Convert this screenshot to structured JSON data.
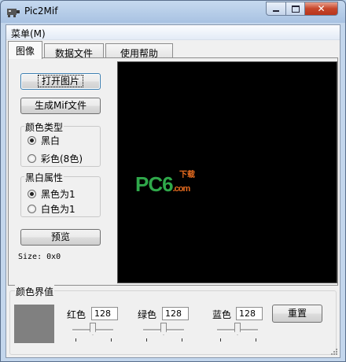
{
  "window": {
    "title": "Pic2Mif"
  },
  "menubar": {
    "menu_label": "菜单(M)"
  },
  "tabs": [
    {
      "label": "图像",
      "active": true
    },
    {
      "label": "数据文件",
      "active": false
    },
    {
      "label": "使用帮助",
      "active": false
    }
  ],
  "image_tab": {
    "open_button": "打开图片",
    "generate_button": "生成Mif文件",
    "color_type": {
      "title": "颜色类型",
      "options": [
        "黑白",
        "彩色(8色)"
      ],
      "selected": "黑白"
    },
    "bw_attr": {
      "title": "黑白属性",
      "options": [
        "黑色为1",
        "白色为1"
      ],
      "selected": "黑色为1"
    },
    "preview_button": "预览",
    "size_text": "Size: 0x0"
  },
  "watermark": {
    "text": "PC6",
    "sub": "下载",
    "domain": ".com"
  },
  "threshold": {
    "title": "颜色界值",
    "preview_color": "#808080",
    "red": {
      "label": "红色",
      "value": "128"
    },
    "green": {
      "label": "绿色",
      "value": "128"
    },
    "blue": {
      "label": "蓝色",
      "value": "128"
    },
    "reset_button": "重置"
  },
  "icons": [
    "app-icon",
    "minimize-icon",
    "maximize-icon",
    "close-icon",
    "resize-grip-icon"
  ]
}
